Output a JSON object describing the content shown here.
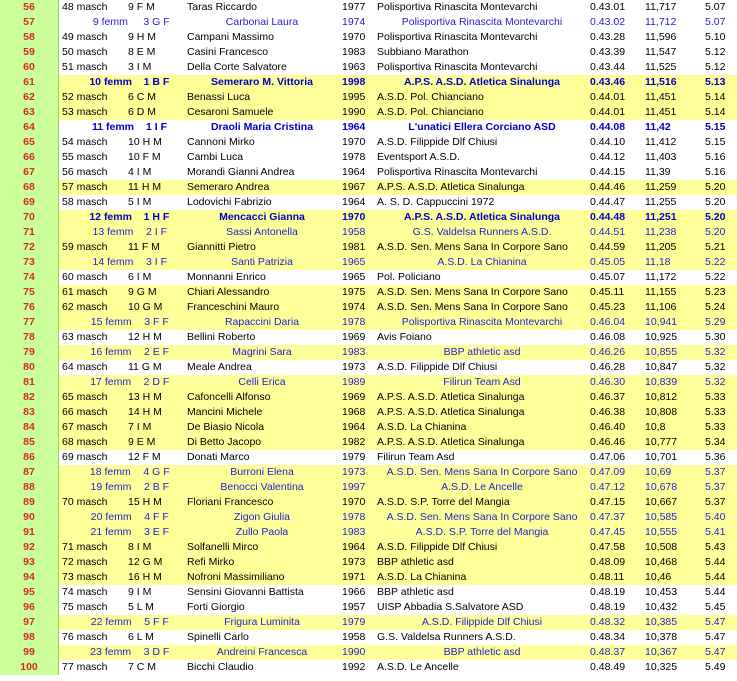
{
  "colors": {
    "yellow_row": "#ffff99",
    "pos_col": "#ccff99",
    "pos_text": "#d12a2a",
    "female_text": "#1f1fd0"
  },
  "rows": [
    {
      "pos": "56",
      "cat": "48 masch",
      "gl": "9 F M",
      "name": "Taras Riccardo",
      "year": "1977",
      "club": "Polisportiva Rinascita Montevarchi",
      "time": "0.43.01",
      "speed": "11,717",
      "pace": "5.07",
      "bg": "white",
      "female": false,
      "bold": false
    },
    {
      "pos": "57",
      "cat": "9 femm",
      "gl": "3 G F",
      "name": "Carbonai Laura",
      "year": "1974",
      "club": "Polisportiva Rinascita Montevarchi",
      "time": "0.43.02",
      "speed": "11,712",
      "pace": "5.07",
      "bg": "white",
      "female": true,
      "bold": false
    },
    {
      "pos": "58",
      "cat": "49 masch",
      "gl": "9 H M",
      "name": "Campani Massimo",
      "year": "1970",
      "club": "Polisportiva Rinascita Montevarchi",
      "time": "0.43.28",
      "speed": "11,596",
      "pace": "5.10",
      "bg": "white",
      "female": false,
      "bold": false
    },
    {
      "pos": "59",
      "cat": "50 masch",
      "gl": "8 E M",
      "name": "Casini Francesco",
      "year": "1983",
      "club": "Subbiano Marathon",
      "time": "0.43.39",
      "speed": "11,547",
      "pace": "5.12",
      "bg": "white",
      "female": false,
      "bold": false
    },
    {
      "pos": "60",
      "cat": "51 masch",
      "gl": "3 I M",
      "name": "Della Corte Salvatore",
      "year": "1963",
      "club": "Polisportiva Rinascita Montevarchi",
      "time": "0.43.44",
      "speed": "11,525",
      "pace": "5.12",
      "bg": "white",
      "female": false,
      "bold": false
    },
    {
      "pos": "61",
      "cat": "10 femm",
      "gl": "1 B F",
      "name": "Semeraro M. Vittoria",
      "year": "1998",
      "club": "A.P.S. A.S.D. Atletica Sinalunga",
      "time": "0.43.46",
      "speed": "11,516",
      "pace": "5.13",
      "bg": "yellow",
      "female": true,
      "bold": true
    },
    {
      "pos": "62",
      "cat": "52 masch",
      "gl": "6 C M",
      "name": "Benassi Luca",
      "year": "1995",
      "club": "A.S.D. Pol. Chianciano",
      "time": "0.44.01",
      "speed": "11,451",
      "pace": "5.14",
      "bg": "yellow",
      "female": false,
      "bold": false
    },
    {
      "pos": "63",
      "cat": "53 masch",
      "gl": "6 D M",
      "name": "Cesaroni Samuele",
      "year": "1990",
      "club": "A.S.D. Pol. Chianciano",
      "time": "0.44.01",
      "speed": "11,451",
      "pace": "5.14",
      "bg": "yellow",
      "female": false,
      "bold": false
    },
    {
      "pos": "64",
      "cat": "11 femm",
      "gl": "1 I F",
      "name": "Draoli Maria Cristina",
      "year": "1964",
      "club": "L'unatici Ellera Corciano ASD",
      "time": "0.44.08",
      "speed": "11,42",
      "pace": "5.15",
      "bg": "white",
      "female": true,
      "bold": true
    },
    {
      "pos": "65",
      "cat": "54 masch",
      "gl": "10 H M",
      "name": "Cannoni Mirko",
      "year": "1970",
      "club": "A.S.D. Filippide Dlf Chiusi",
      "time": "0.44.10",
      "speed": "11,412",
      "pace": "5.15",
      "bg": "white",
      "female": false,
      "bold": false
    },
    {
      "pos": "66",
      "cat": "55 masch",
      "gl": "10 F M",
      "name": "Cambi Luca",
      "year": "1978",
      "club": "Eventsport A.S.D.",
      "time": "0.44.12",
      "speed": "11,403",
      "pace": "5.16",
      "bg": "white",
      "female": false,
      "bold": false
    },
    {
      "pos": "67",
      "cat": "56 masch",
      "gl": "4 I M",
      "name": "Morandi Gianni Andrea",
      "year": "1964",
      "club": "Polisportiva Rinascita Montevarchi",
      "time": "0.44.15",
      "speed": "11,39",
      "pace": "5.16",
      "bg": "white",
      "female": false,
      "bold": false
    },
    {
      "pos": "68",
      "cat": "57 masch",
      "gl": "11 H M",
      "name": "Semeraro Andrea",
      "year": "1967",
      "club": "A.P.S. A.S.D. Atletica Sinalunga",
      "time": "0.44.46",
      "speed": "11,259",
      "pace": "5.20",
      "bg": "yellow",
      "female": false,
      "bold": false
    },
    {
      "pos": "69",
      "cat": "58 masch",
      "gl": "5 I M",
      "name": "Lodovichi Fabrizio",
      "year": "1964",
      "club": "A. S. D. Cappuccini 1972",
      "time": "0.44.47",
      "speed": "11,255",
      "pace": "5.20",
      "bg": "white",
      "female": false,
      "bold": false
    },
    {
      "pos": "70",
      "cat": "12 femm",
      "gl": "1 H F",
      "name": "Mencacci Gianna",
      "year": "1970",
      "club": "A.P.S. A.S.D. Atletica Sinalunga",
      "time": "0.44.48",
      "speed": "11,251",
      "pace": "5.20",
      "bg": "yellow",
      "female": true,
      "bold": true
    },
    {
      "pos": "71",
      "cat": "13 femm",
      "gl": "2 I F",
      "name": "Sassi Antonella",
      "year": "1958",
      "club": "G.S. Valdelsa Runners A.S.D.",
      "time": "0.44.51",
      "speed": "11,238",
      "pace": "5.20",
      "bg": "yellow",
      "female": true,
      "bold": false
    },
    {
      "pos": "72",
      "cat": "59 masch",
      "gl": "11 F M",
      "name": "Giannitti Pietro",
      "year": "1981",
      "club": "A.S.D. Sen. Mens Sana In Corpore Sano",
      "time": "0.44.59",
      "speed": "11,205",
      "pace": "5.21",
      "bg": "yellow",
      "female": false,
      "bold": false
    },
    {
      "pos": "73",
      "cat": "14 femm",
      "gl": "3 I F",
      "name": "Santi Patrizia",
      "year": "1965",
      "club": "A.S.D. La Chianina",
      "time": "0.45.05",
      "speed": "11,18",
      "pace": "5.22",
      "bg": "yellow",
      "female": true,
      "bold": false
    },
    {
      "pos": "74",
      "cat": "60 masch",
      "gl": "6 I M",
      "name": "Monnanni Enrico",
      "year": "1965",
      "club": "Pol. Policiano",
      "time": "0.45.07",
      "speed": "11,172",
      "pace": "5.22",
      "bg": "white",
      "female": false,
      "bold": false
    },
    {
      "pos": "75",
      "cat": "61 masch",
      "gl": "9 G M",
      "name": "Chiari Alessandro",
      "year": "1975",
      "club": "A.S.D. Sen. Mens Sana In Corpore Sano",
      "time": "0.45.11",
      "speed": "11,155",
      "pace": "5.23",
      "bg": "yellow",
      "female": false,
      "bold": false
    },
    {
      "pos": "76",
      "cat": "62 masch",
      "gl": "10 G M",
      "name": "Franceschini Mauro",
      "year": "1974",
      "club": "A.S.D. Sen. Mens Sana In Corpore Sano",
      "time": "0.45.23",
      "speed": "11,106",
      "pace": "5.24",
      "bg": "yellow",
      "female": false,
      "bold": false
    },
    {
      "pos": "77",
      "cat": "15 femm",
      "gl": "3 F F",
      "name": "Rapaccini Daria",
      "year": "1978",
      "club": "Polisportiva Rinascita Montevarchi",
      "time": "0.46.04",
      "speed": "10,941",
      "pace": "5.29",
      "bg": "yellow",
      "female": true,
      "bold": false
    },
    {
      "pos": "78",
      "cat": "63 masch",
      "gl": "12 H M",
      "name": "Bellini Roberto",
      "year": "1969",
      "club": "Avis Foiano",
      "time": "0.46.08",
      "speed": "10,925",
      "pace": "5.30",
      "bg": "white",
      "female": false,
      "bold": false
    },
    {
      "pos": "79",
      "cat": "16 femm",
      "gl": "2 E F",
      "name": "Magrini Sara",
      "year": "1983",
      "club": "BBP athletic asd",
      "time": "0.46.26",
      "speed": "10,855",
      "pace": "5.32",
      "bg": "yellow",
      "female": true,
      "bold": false
    },
    {
      "pos": "80",
      "cat": "64 masch",
      "gl": "11 G M",
      "name": "Meale Andrea",
      "year": "1973",
      "club": "A.S.D. Filippide Dlf Chiusi",
      "time": "0.46.28",
      "speed": "10,847",
      "pace": "5.32",
      "bg": "white",
      "female": false,
      "bold": false
    },
    {
      "pos": "81",
      "cat": "17 femm",
      "gl": "2 D F",
      "name": "Celli Erica",
      "year": "1989",
      "club": "Filirun Team Asd",
      "time": "0.46.30",
      "speed": "10,839",
      "pace": "5.32",
      "bg": "yellow",
      "female": true,
      "bold": false
    },
    {
      "pos": "82",
      "cat": "65 masch",
      "gl": "13 H M",
      "name": "Cafoncelli Alfonso",
      "year": "1969",
      "club": "A.P.S. A.S.D. Atletica Sinalunga",
      "time": "0.46.37",
      "speed": "10,812",
      "pace": "5.33",
      "bg": "yellow",
      "female": false,
      "bold": false
    },
    {
      "pos": "83",
      "cat": "66 masch",
      "gl": "14 H M",
      "name": "Mancini Michele",
      "year": "1968",
      "club": "A.P.S. A.S.D. Atletica Sinalunga",
      "time": "0.46.38",
      "speed": "10,808",
      "pace": "5.33",
      "bg": "yellow",
      "female": false,
      "bold": false
    },
    {
      "pos": "84",
      "cat": "67 masch",
      "gl": "7 I M",
      "name": "De Biasio Nicola",
      "year": "1964",
      "club": "A.S.D. La Chianina",
      "time": "0.46.40",
      "speed": "10,8",
      "pace": "5.33",
      "bg": "yellow",
      "female": false,
      "bold": false
    },
    {
      "pos": "85",
      "cat": "68 masch",
      "gl": "9 E M",
      "name": "Di Betto Jacopo",
      "year": "1982",
      "club": "A.P.S. A.S.D. Atletica Sinalunga",
      "time": "0.46.46",
      "speed": "10,777",
      "pace": "5.34",
      "bg": "yellow",
      "female": false,
      "bold": false
    },
    {
      "pos": "86",
      "cat": "69 masch",
      "gl": "12 F M",
      "name": "Donati Marco",
      "year": "1979",
      "club": "Filirun Team Asd",
      "time": "0.47.06",
      "speed": "10,701",
      "pace": "5.36",
      "bg": "white",
      "female": false,
      "bold": false
    },
    {
      "pos": "87",
      "cat": "18 femm",
      "gl": "4 G F",
      "name": "Burroni Elena",
      "year": "1973",
      "club": "A.S.D. Sen. Mens Sana In Corpore Sano",
      "time": "0.47.09",
      "speed": "10,69",
      "pace": "5.37",
      "bg": "yellow",
      "female": true,
      "bold": false
    },
    {
      "pos": "88",
      "cat": "19 femm",
      "gl": "2 B F",
      "name": "Benocci Valentina",
      "year": "1997",
      "club": "A.S.D. Le Ancelle",
      "time": "0.47.12",
      "speed": "10,678",
      "pace": "5.37",
      "bg": "yellow",
      "female": true,
      "bold": false
    },
    {
      "pos": "89",
      "cat": "70 masch",
      "gl": "15 H M",
      "name": "Floriani Francesco",
      "year": "1970",
      "club": "A.S.D. S.P. Torre del Mangia",
      "time": "0.47.15",
      "speed": "10,667",
      "pace": "5.37",
      "bg": "yellow",
      "female": false,
      "bold": false
    },
    {
      "pos": "90",
      "cat": "20 femm",
      "gl": "4 F F",
      "name": "Zigon Giulia",
      "year": "1978",
      "club": "A.S.D. Sen. Mens Sana In Corpore Sano",
      "time": "0.47.37",
      "speed": "10,585",
      "pace": "5.40",
      "bg": "yellow",
      "female": true,
      "bold": false
    },
    {
      "pos": "91",
      "cat": "21 femm",
      "gl": "3 E F",
      "name": "Zullo Paola",
      "year": "1983",
      "club": "A.S.D. S.P. Torre del Mangia",
      "time": "0.47.45",
      "speed": "10,555",
      "pace": "5.41",
      "bg": "yellow",
      "female": true,
      "bold": false
    },
    {
      "pos": "92",
      "cat": "71 masch",
      "gl": "8 I M",
      "name": "Solfanelli Mirco",
      "year": "1964",
      "club": "A.S.D. Filippide Dlf Chiusi",
      "time": "0.47.58",
      "speed": "10,508",
      "pace": "5.43",
      "bg": "yellow",
      "female": false,
      "bold": false
    },
    {
      "pos": "93",
      "cat": "72 masch",
      "gl": "12 G M",
      "name": "Refi Mirko",
      "year": "1973",
      "club": "BBP athletic asd",
      "time": "0.48.09",
      "speed": "10,468",
      "pace": "5.44",
      "bg": "yellow",
      "female": false,
      "bold": false
    },
    {
      "pos": "94",
      "cat": "73 masch",
      "gl": "16 H M",
      "name": "Nofroni Massimiliano",
      "year": "1971",
      "club": "A.S.D. La Chianina",
      "time": "0.48.11",
      "speed": "10,46",
      "pace": "5.44",
      "bg": "yellow",
      "female": false,
      "bold": false
    },
    {
      "pos": "95",
      "cat": "74 masch",
      "gl": "9 I M",
      "name": "Sensini Giovanni Battista",
      "year": "1966",
      "club": "BBP athletic asd",
      "time": "0.48.19",
      "speed": "10,453",
      "pace": "5.44",
      "bg": "white",
      "female": false,
      "bold": false
    },
    {
      "pos": "96",
      "cat": "75 masch",
      "gl": "5 L M",
      "name": "Forti Giorgio",
      "year": "1957",
      "club": "UISP Abbadia S.Salvatore ASD",
      "time": "0.48.19",
      "speed": "10,432",
      "pace": "5.45",
      "bg": "white",
      "female": false,
      "bold": false
    },
    {
      "pos": "97",
      "cat": "22 femm",
      "gl": "5 F F",
      "name": "Frigura  Luminita",
      "year": "1979",
      "club": "A.S.D. Filippide Dlf Chiusi",
      "time": "0.48.32",
      "speed": "10,385",
      "pace": "5.47",
      "bg": "yellow",
      "female": true,
      "bold": false
    },
    {
      "pos": "98",
      "cat": "76 masch",
      "gl": "6 L M",
      "name": "Spinelli Carlo",
      "year": "1958",
      "club": "G.S. Valdelsa Runners A.S.D.",
      "time": "0.48.34",
      "speed": "10,378",
      "pace": "5.47",
      "bg": "white",
      "female": false,
      "bold": false
    },
    {
      "pos": "99",
      "cat": "23 femm",
      "gl": "3 D F",
      "name": "Andreini Francesca",
      "year": "1990",
      "club": "BBP athletic asd",
      "time": "0.48.37",
      "speed": "10,367",
      "pace": "5.47",
      "bg": "yellow",
      "female": true,
      "bold": false
    },
    {
      "pos": "100",
      "cat": "77 masch",
      "gl": "7 C M",
      "name": "Bicchi Claudio",
      "year": "1992",
      "club": "A.S.D. Le Ancelle",
      "time": "0.48.49",
      "speed": "10,325",
      "pace": "5.49",
      "bg": "white",
      "female": false,
      "bold": false
    }
  ]
}
